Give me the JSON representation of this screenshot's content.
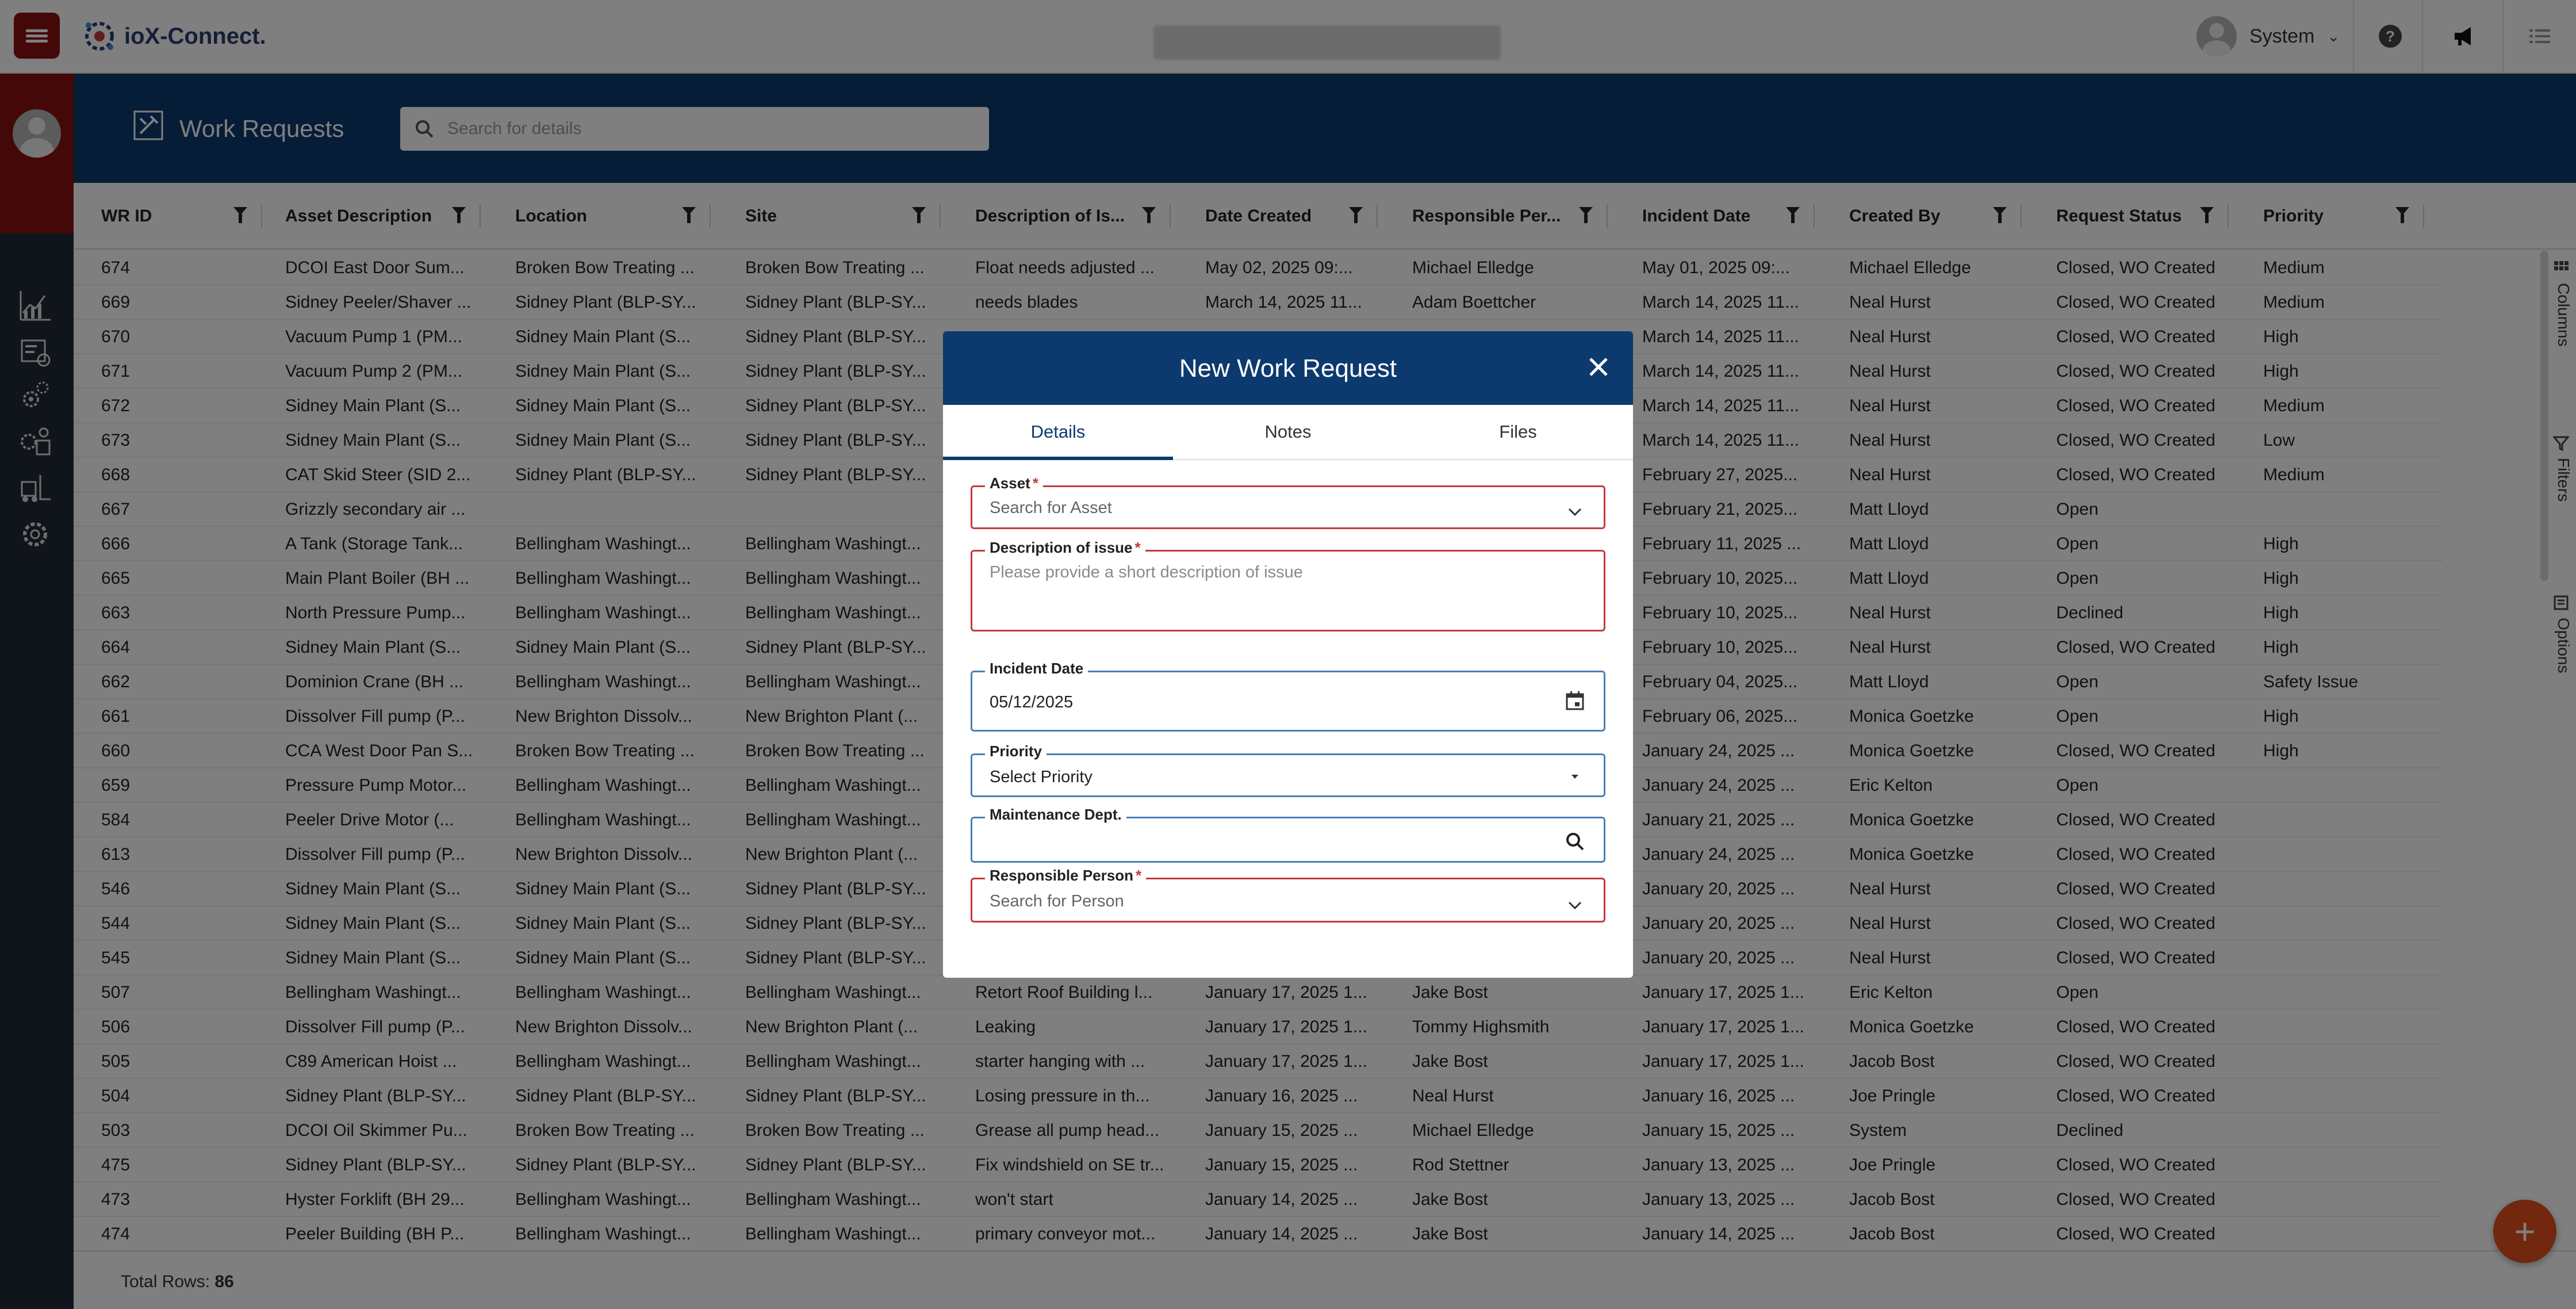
{
  "app": {
    "name": "ioX-Connect."
  },
  "topbar": {
    "user_name": "System"
  },
  "header": {
    "title": "Work Requests",
    "search_placeholder": "Search for details"
  },
  "table": {
    "columns": [
      "WR ID",
      "Asset Description",
      "Location",
      "Site",
      "Description of Is...",
      "Date Created",
      "Responsible Per...",
      "Incident Date",
      "Created By",
      "Request Status",
      "Priority"
    ],
    "rows": [
      [
        "674",
        "DCOI East Door Sum...",
        "Broken Bow Treating ...",
        "Broken Bow Treating ...",
        "Float needs adjusted ...",
        "May 02, 2025 09:...",
        "Michael Elledge",
        "May 01, 2025 09:...",
        "Michael Elledge",
        "Closed, WO Created",
        "Medium"
      ],
      [
        "669",
        "Sidney Peeler/Shaver ...",
        "Sidney Plant (BLP-SY...",
        "Sidney Plant (BLP-SY...",
        "needs blades",
        "March 14, 2025 11...",
        "Adam Boettcher",
        "March 14, 2025 11...",
        "Neal Hurst",
        "Closed, WO Created",
        "Medium"
      ],
      [
        "670",
        "Vacuum Pump 1 (PM...",
        "Sidney Main Plant (S...",
        "Sidney Plant (BLP-SY...",
        "",
        "",
        "",
        "March 14, 2025 11...",
        "Neal Hurst",
        "Closed, WO Created",
        "High"
      ],
      [
        "671",
        "Vacuum Pump 2 (PM...",
        "Sidney Main Plant (S...",
        "Sidney Plant (BLP-SY...",
        "",
        "",
        "",
        "March 14, 2025 11...",
        "Neal Hurst",
        "Closed, WO Created",
        "High"
      ],
      [
        "672",
        "Sidney Main Plant (S...",
        "Sidney Main Plant (S...",
        "Sidney Plant (BLP-SY...",
        "",
        "",
        "",
        "March 14, 2025 11...",
        "Neal Hurst",
        "Closed, WO Created",
        "Medium"
      ],
      [
        "673",
        "Sidney Main Plant (S...",
        "Sidney Main Plant (S...",
        "Sidney Plant (BLP-SY...",
        "",
        "",
        "",
        "March 14, 2025 11...",
        "Neal Hurst",
        "Closed, WO Created",
        "Low"
      ],
      [
        "668",
        "CAT Skid Steer (SID 2...",
        "Sidney Plant (BLP-SY...",
        "Sidney Plant (BLP-SY...",
        "",
        "",
        "",
        "February 27, 2025...",
        "Neal Hurst",
        "Closed, WO Created",
        "Medium"
      ],
      [
        "667",
        "Grizzly secondary air ...",
        "",
        "",
        "",
        "",
        "",
        "February 21, 2025...",
        "Matt Lloyd",
        "Open",
        ""
      ],
      [
        "666",
        "A Tank (Storage Tank...",
        "Bellingham Washingt...",
        "Bellingham Washingt...",
        "",
        "",
        "",
        "February 11, 2025 ...",
        "Matt Lloyd",
        "Open",
        "High"
      ],
      [
        "665",
        "Main Plant Boiler (BH ...",
        "Bellingham Washingt...",
        "Bellingham Washingt...",
        "",
        "",
        "",
        "February 10, 2025...",
        "Matt Lloyd",
        "Open",
        "High"
      ],
      [
        "663",
        "North Pressure Pump...",
        "Bellingham Washingt...",
        "Bellingham Washingt...",
        "",
        "",
        "",
        "February 10, 2025...",
        "Neal Hurst",
        "Declined",
        "High"
      ],
      [
        "664",
        "Sidney Main Plant (S...",
        "Sidney Main Plant (S...",
        "Sidney Plant (BLP-SY...",
        "",
        "",
        "",
        "February 10, 2025...",
        "Neal Hurst",
        "Closed, WO Created",
        "High"
      ],
      [
        "662",
        "Dominion Crane (BH ...",
        "Bellingham Washingt...",
        "Bellingham Washingt...",
        "",
        "",
        "",
        "February 04, 2025...",
        "Matt Lloyd",
        "Open",
        "Safety Issue"
      ],
      [
        "661",
        "Dissolver Fill pump (P...",
        "New Brighton Dissolv...",
        "New Brighton Plant (...",
        "",
        "",
        "",
        "February 06, 2025...",
        "Monica Goetzke",
        "Open",
        "High"
      ],
      [
        "660",
        "CCA West Door Pan S...",
        "Broken Bow Treating ...",
        "Broken Bow Treating ...",
        "",
        "",
        "",
        "January 24, 2025 ...",
        "Monica Goetzke",
        "Closed, WO Created",
        "High"
      ],
      [
        "659",
        "Pressure Pump Motor...",
        "Bellingham Washingt...",
        "Bellingham Washingt...",
        "",
        "",
        "",
        "January 24, 2025 ...",
        "Eric Kelton",
        "Open",
        ""
      ],
      [
        "584",
        "Peeler Drive Motor (...",
        "Bellingham Washingt...",
        "Bellingham Washingt...",
        "",
        "",
        "",
        "January 21, 2025 ...",
        "Monica Goetzke",
        "Closed, WO Created",
        ""
      ],
      [
        "613",
        "Dissolver Fill pump (P...",
        "New Brighton Dissolv...",
        "New Brighton Plant (...",
        "",
        "",
        "",
        "January 24, 2025 ...",
        "Monica Goetzke",
        "Closed, WO Created",
        ""
      ],
      [
        "546",
        "Sidney Main Plant (S...",
        "Sidney Main Plant (S...",
        "Sidney Plant (BLP-SY...",
        "",
        "",
        "",
        "January 20, 2025 ...",
        "Neal Hurst",
        "Closed, WO Created",
        ""
      ],
      [
        "544",
        "Sidney Main Plant (S...",
        "Sidney Main Plant (S...",
        "Sidney Plant (BLP-SY...",
        "",
        "",
        "",
        "January 20, 2025 ...",
        "Neal Hurst",
        "Closed, WO Created",
        ""
      ],
      [
        "545",
        "Sidney Main Plant (S...",
        "Sidney Main Plant (S...",
        "Sidney Plant (BLP-SY...",
        "",
        "",
        "",
        "January 20, 2025 ...",
        "Neal Hurst",
        "Closed, WO Created",
        ""
      ],
      [
        "507",
        "Bellingham Washingt...",
        "Bellingham Washingt...",
        "Bellingham Washingt...",
        "Retort Roof Building l...",
        "January 17, 2025 1...",
        "Jake Bost",
        "January 17, 2025 1...",
        "Eric Kelton",
        "Open",
        ""
      ],
      [
        "506",
        "Dissolver Fill pump (P...",
        "New Brighton Dissolv...",
        "New Brighton Plant (...",
        "Leaking",
        "January 17, 2025 1...",
        "Tommy Highsmith",
        "January 17, 2025 1...",
        "Monica Goetzke",
        "Closed, WO Created",
        ""
      ],
      [
        "505",
        "C89 American Hoist ...",
        "Bellingham Washingt...",
        "Bellingham Washingt...",
        "starter hanging with ...",
        "January 17, 2025 1...",
        "Jake Bost",
        "January 17, 2025 1...",
        "Jacob Bost",
        "Closed, WO Created",
        ""
      ],
      [
        "504",
        "Sidney Plant (BLP-SY...",
        "Sidney Plant (BLP-SY...",
        "Sidney Plant (BLP-SY...",
        "Losing pressure in th...",
        "January 16, 2025 ...",
        "Neal Hurst",
        "January 16, 2025 ...",
        "Joe Pringle",
        "Closed, WO Created",
        ""
      ],
      [
        "503",
        "DCOI Oil Skimmer Pu...",
        "Broken Bow Treating ...",
        "Broken Bow Treating ...",
        "Grease all pump head...",
        "January 15, 2025 ...",
        "Michael Elledge",
        "January 15, 2025 ...",
        "System",
        "Declined",
        ""
      ],
      [
        "475",
        "Sidney Plant (BLP-SY...",
        "Sidney Plant (BLP-SY...",
        "Sidney Plant (BLP-SY...",
        "Fix windshield on SE tr...",
        "January 15, 2025 ...",
        "Rod Stettner",
        "January 13, 2025 ...",
        "Joe Pringle",
        "Closed, WO Created",
        ""
      ],
      [
        "473",
        "Hyster Forklift (BH 29...",
        "Bellingham Washingt...",
        "Bellingham Washingt...",
        "won't start",
        "January 14, 2025 ...",
        "Jake Bost",
        "January 13, 2025 ...",
        "Jacob Bost",
        "Closed, WO Created",
        ""
      ],
      [
        "474",
        "Peeler Building (BH P...",
        "Bellingham Washingt...",
        "Bellingham Washingt...",
        "primary conveyor mot...",
        "January 14, 2025 ...",
        "Jake Bost",
        "January 14, 2025 ...",
        "Jacob Bost",
        "Closed, WO Created",
        ""
      ]
    ],
    "footer_label": "Total Rows:",
    "footer_count": "86"
  },
  "side_tools": {
    "columns": "Columns",
    "filters": "Filters",
    "options": "Options"
  },
  "modal": {
    "title": "New Work Request",
    "tabs": [
      "Details",
      "Notes",
      "Files"
    ],
    "active_tab": "Details",
    "asset": {
      "label": "Asset",
      "placeholder": "Search for Asset"
    },
    "description": {
      "label": "Description of issue",
      "placeholder": "Please provide a short description of issue"
    },
    "incident_date": {
      "label": "Incident Date",
      "value": "05/12/2025"
    },
    "priority": {
      "label": "Priority",
      "value": "Select Priority"
    },
    "maintenance_dept": {
      "label": "Maintenance Dept.",
      "value": ""
    },
    "responsible_person": {
      "label": "Responsible Person",
      "placeholder": "Search for Person"
    },
    "required_mark": "*"
  },
  "colors": {
    "brand_red": "#8b1010",
    "header_blue": "#0d3a6e",
    "fab_orange": "#e3501e",
    "error_red": "#c23a3a"
  },
  "icons": [
    "menu-icon",
    "logo-icon",
    "help-icon",
    "announcement-icon",
    "list-icon",
    "work-request-icon",
    "search-icon",
    "filter-icon",
    "analytics-icon",
    "equipment-icon",
    "settings-icon",
    "forklift-icon",
    "calendar-icon",
    "chevron-down-icon",
    "close-icon",
    "plus-icon"
  ]
}
